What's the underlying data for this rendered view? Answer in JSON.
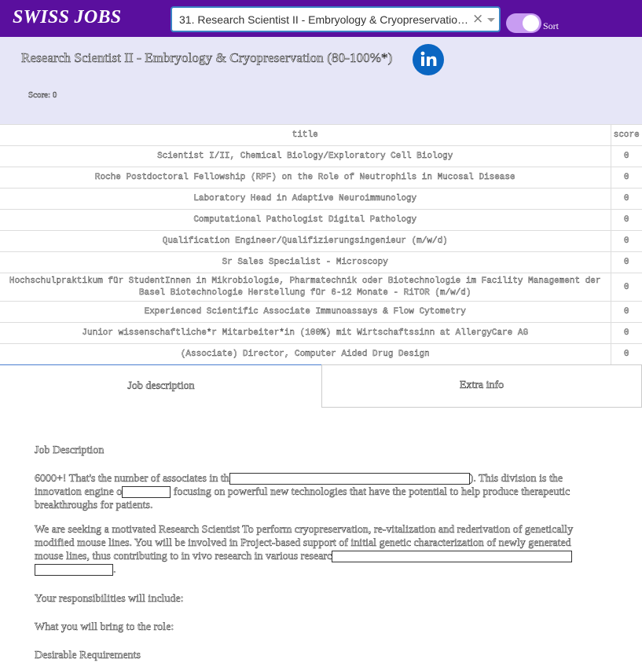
{
  "app": {
    "brand": "SWISS JOBS"
  },
  "search": {
    "selected_value": "31. Research Scientist II - Embryology & Cryopreservation (80-100%*)",
    "clear_icon": "×"
  },
  "sort_toggle": {
    "label": "Sort",
    "enabled": true
  },
  "job": {
    "title": "Research Scientist II - Embryology & Cryopreservation (80-100%*)",
    "score_text": "Score: 0"
  },
  "table": {
    "headers": [
      "title",
      "score"
    ],
    "rows": [
      {
        "title": "Scientist I/II, Chemical Biology/Exploratory Cell Biology",
        "score": "0"
      },
      {
        "title": "Roche Postdoctoral Fellowship (RPF) on the Role of Neutrophils in Mucosal Disease",
        "score": "0"
      },
      {
        "title": "Laboratory Head in Adaptive Neuroimmunology",
        "score": "0"
      },
      {
        "title": "Computational Pathologist Digital Pathology",
        "score": "0"
      },
      {
        "title": "Qualification Engineer/Qualifizierungsingenieur (m/w/d)",
        "score": "0"
      },
      {
        "title": "Sr Sales Specialist - Microscopy",
        "score": "0"
      },
      {
        "title": "Hochschulpraktikum für StudentInnen in Mikrobiologie, Pharmatechnik oder Biotechnologie im Facility Management der Basel Biotechnologie Herstellung für 6-12 Monate - RiTOR (m/w/d)",
        "score": "0"
      },
      {
        "title": "Experienced Scientific Associate Immunoassays & Flow Cytometry",
        "score": "0"
      },
      {
        "title": "Junior wissenschaftliche*r Mitarbeiter*in (100%) mit Wirtschaftssinn at AllergyCare AG",
        "score": "0"
      },
      {
        "title": "(Associate) Director, Computer Aided Drug Design",
        "score": "0"
      }
    ]
  },
  "tabs": {
    "description": "Job description",
    "extra": "Extra info"
  },
  "description": {
    "heading": "Job Description",
    "p1_before": "6000+! That's the number of associates in th",
    "p1_mid": "). This division is the innovation engine o",
    "p1_after": " focusing on powerful new technologies that have the potential to help produce therapeutic breakthroughs for patients.",
    "p2_before": "We are seeking a motivated Research Scientist To perform cryopreservation, re-vitalization and rederivation of genetically modified mouse lines. You will be involved in Project-based support of initial genetic characterization of newly generated mouse lines, thus contributing to in vivo research in various researc",
    "p2_after": ".",
    "responsibilities": "Your responsibilities will include:",
    "bring": "What you will bring to the role:",
    "desirable": "Desirable Requirements"
  }
}
